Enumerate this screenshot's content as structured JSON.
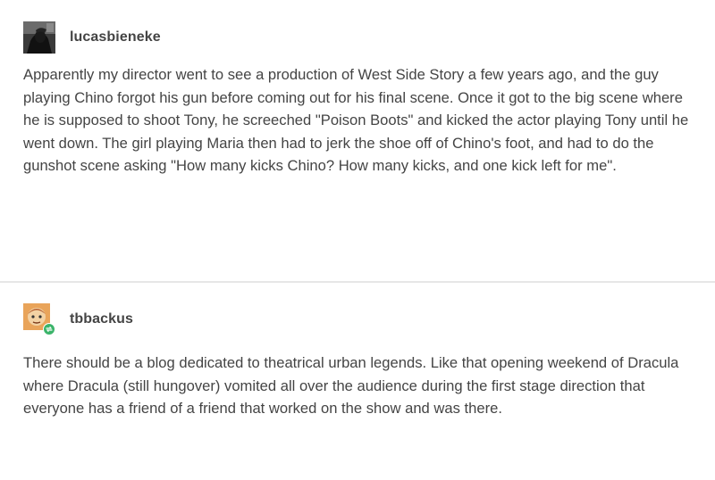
{
  "posts": [
    {
      "username": "lucasbieneke",
      "avatar_icon": "user-avatar-dark-icon",
      "body": "Apparently my director went to see a production of West Side Story a few years ago, and the guy playing Chino forgot his gun before coming out for his final scene. Once it got to the big scene where he is supposed to shoot Tony, he screeched \"Poison Boots\" and kicked the actor playing Tony until he went down. The girl playing Maria then had to jerk the shoe off of Chino's foot, and had to do the gunshot scene asking \"How many kicks Chino? How many kicks, and one kick left for me\"."
    },
    {
      "username": "tbbackus",
      "avatar_icon": "user-avatar-cartoon-icon",
      "badge_icon": "reblog-badge-icon",
      "body": "There should be a blog dedicated to theatrical urban legends. Like that opening weekend of Dracula where Dracula (still hungover) vomited all over the audience during the first stage direction that everyone has a friend of a friend that worked on the show and was there."
    }
  ],
  "colors": {
    "text": "#444444",
    "divider": "#e6e6e6",
    "badge": "#3bb46a",
    "avatar2_bg": "#e9a45a"
  }
}
